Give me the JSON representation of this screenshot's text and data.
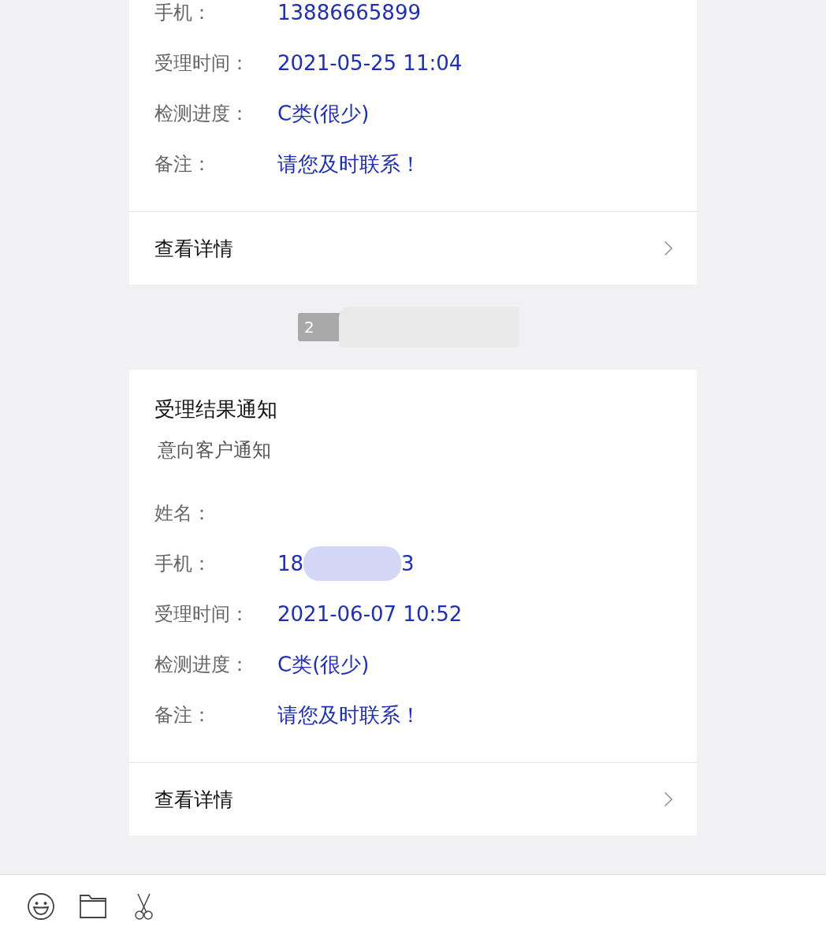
{
  "messages": [
    {
      "kind": "card",
      "fields": [
        {
          "label": "手机：",
          "value": "13886665899"
        },
        {
          "label": "受理时间：",
          "value": "2021-05-25 11:04"
        },
        {
          "label": "检测进度：",
          "value": "C类(很少)"
        },
        {
          "label": "备注：",
          "value": "请您及时联系！"
        }
      ],
      "link": "查看详情"
    },
    {
      "kind": "time",
      "text": "2"
    },
    {
      "kind": "card",
      "title": "受理结果通知",
      "subtitle": "意向客户通知",
      "fields": [
        {
          "label": "姓名："
        },
        {
          "label": "手机：",
          "value": "18",
          "value_end": "3",
          "redacted": true
        },
        {
          "label": "受理时间：",
          "value": "2021-06-07 10:52"
        },
        {
          "label": "检测进度：",
          "value": "C类(很少)"
        },
        {
          "label": "备注：",
          "value": "请您及时联系！"
        }
      ],
      "link": "查看详情"
    }
  ],
  "toolbar": [
    {
      "kind": "emoji"
    },
    {
      "kind": "folder"
    },
    {
      "kind": "scissors"
    }
  ]
}
